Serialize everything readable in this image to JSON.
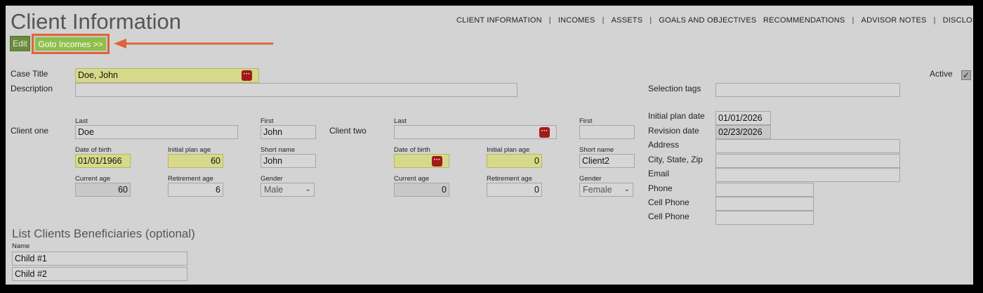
{
  "page": {
    "title": "Client Information"
  },
  "nav": [
    "CLIENT INFORMATION",
    "INCOMES",
    "ASSETS",
    "GOALS AND OBJECTIVES",
    "RECOMMENDATIONS",
    "ADVISOR NOTES",
    "DISCLOSURE"
  ],
  "toolbar": {
    "edit_label": "Edit",
    "goto_label": "Goto Incomes >>"
  },
  "case": {
    "title_label": "Case Title",
    "title_value": "Doe, John",
    "description_label": "Description",
    "description_value": "",
    "active_label": "Active",
    "active_checked": true,
    "selection_tags_label": "Selection tags",
    "selection_tags_value": ""
  },
  "client_one": {
    "label": "Client one",
    "last_label": "Last",
    "last_value": "Doe",
    "first_label": "First",
    "first_value": "John",
    "dob_label": "Date of birth",
    "dob_value": "01/01/1966",
    "plan_age_label": "Initial plan age",
    "plan_age_value": "60",
    "short_name_label": "Short name",
    "short_name_value": "John",
    "current_age_label": "Current age",
    "current_age_value": "60",
    "retirement_age_label": "Retirement age",
    "retirement_age_value": "6",
    "gender_label": "Gender",
    "gender_value": "Male"
  },
  "client_two": {
    "label": "Client two",
    "last_label": "Last",
    "last_value": "",
    "first_label": "First",
    "first_value": "",
    "dob_label": "Date of birth",
    "dob_value": "",
    "plan_age_label": "Initial plan age",
    "plan_age_value": "0",
    "short_name_label": "Short name",
    "short_name_value": "Client2",
    "current_age_label": "Current age",
    "current_age_value": "0",
    "retirement_age_label": "Retirement age",
    "retirement_age_value": "0",
    "gender_label": "Gender",
    "gender_value": "Female"
  },
  "contact": {
    "initial_plan_date_label": "Initial plan date",
    "initial_plan_date_value": "01/01/2026",
    "revision_date_label": "Revision date",
    "revision_date_value": "02/23/2026",
    "address_label": "Address",
    "address_value": "",
    "city_label": "City, State, Zip",
    "city_value": "",
    "email_label": "Email",
    "email_value": "",
    "phone_label": "Phone",
    "phone_value": "",
    "cell_phone_label": "Cell Phone",
    "cell_phone_value": "",
    "cell_phone2_label": "Cell Phone",
    "cell_phone2_value": ""
  },
  "beneficiaries": {
    "heading": "List Clients Beneficiaries (optional)",
    "name_label": "Name",
    "items": [
      "Child #1",
      "Child #2"
    ]
  },
  "colors": {
    "accent_green": "#8fbf4a",
    "highlight_orange": "#e0643a",
    "required_yellow": "#d6d98a",
    "alert_red": "#a11a1a"
  }
}
